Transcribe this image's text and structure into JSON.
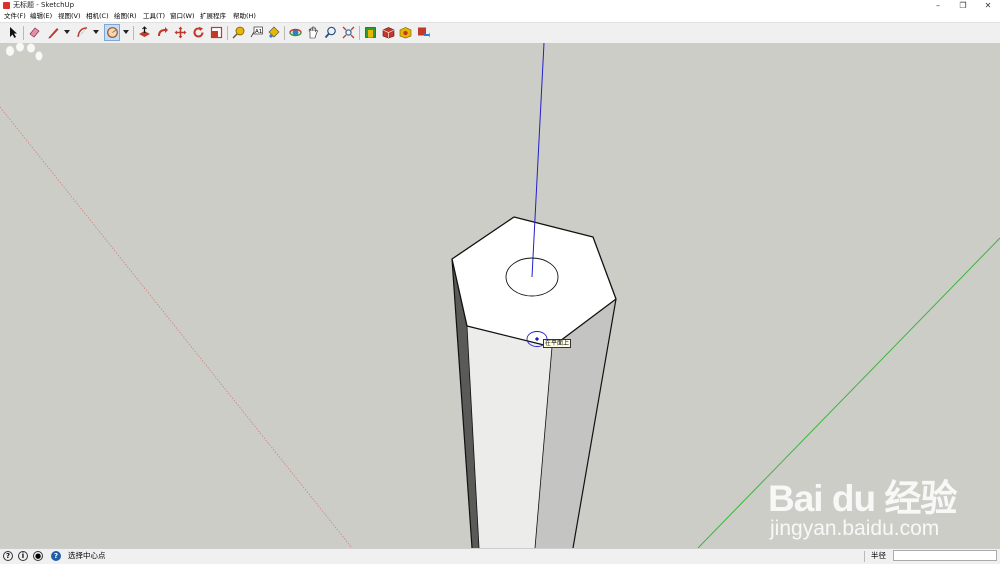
{
  "window": {
    "title": "无标题 - SketchUp",
    "minimize": "–",
    "restore": "❐",
    "close": "✕"
  },
  "menu": {
    "items": [
      "文件(F)",
      "编辑(E)",
      "视图(V)",
      "相机(C)",
      "绘图(R)",
      "工具(T)",
      "窗口(W)",
      "扩展程序",
      "帮助(H)"
    ]
  },
  "toolbar": {
    "tools": [
      "select-icon",
      "eraser-icon",
      "pencil-icon",
      "arc-icon",
      "circle-icon",
      "push-pull-icon",
      "follow-me-icon",
      "move-icon",
      "rotate-icon",
      "scale-icon",
      "tape-measure-icon",
      "text-icon",
      "paint-bucket-icon",
      "orbit-icon",
      "pan-icon",
      "zoom-icon",
      "zoom-extents-icon",
      "warehouse-icon",
      "extension-icon",
      "components-icon",
      "share-icon"
    ],
    "active_tool": "circle-icon"
  },
  "viewport": {
    "background": "#cdcdc8",
    "tooltip": "在平面上",
    "axis_colors": {
      "red": "#d08080",
      "green": "#3cb43c",
      "blue": "#2020c8"
    }
  },
  "watermark": {
    "logo": "Bai du 经验",
    "url": "jingyan.baidu.com"
  },
  "status": {
    "message": "选择中心点",
    "field_label": "半径",
    "field_value": ""
  }
}
